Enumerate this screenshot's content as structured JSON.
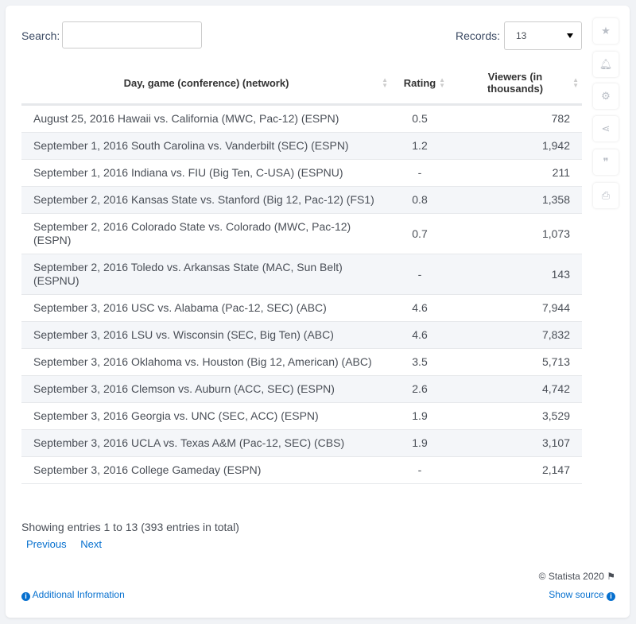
{
  "search": {
    "label": "Search:",
    "value": ""
  },
  "records": {
    "label": "Records:",
    "value": "13"
  },
  "columns": [
    "Day, game (conference) (network)",
    "Rating",
    "Viewers (in thousands)"
  ],
  "rows": [
    [
      "August 25, 2016 Hawaii vs. California (MWC, Pac-12) (ESPN)",
      "0.5",
      "782"
    ],
    [
      "September 1, 2016 South Carolina vs. Vanderbilt (SEC) (ESPN)",
      "1.2",
      "1,942"
    ],
    [
      "September 1, 2016 Indiana vs. FIU (Big Ten, C-USA) (ESPNU)",
      "-",
      "211"
    ],
    [
      "September 2, 2016 Kansas State vs. Stanford (Big 12, Pac-12) (FS1)",
      "0.8",
      "1,358"
    ],
    [
      "September 2, 2016 Colorado State vs. Colorado (MWC, Pac-12) (ESPN)",
      "0.7",
      "1,073"
    ],
    [
      "September 2, 2016 Toledo vs. Arkansas State (MAC, Sun Belt) (ESPNU)",
      "-",
      "143"
    ],
    [
      "September 3, 2016 USC vs. Alabama (Pac-12, SEC) (ABC)",
      "4.6",
      "7,944"
    ],
    [
      "September 3, 2016 LSU vs. Wisconsin (SEC, Big Ten) (ABC)",
      "4.6",
      "7,832"
    ],
    [
      "September 3, 2016 Oklahoma vs. Houston (Big 12, American) (ABC)",
      "3.5",
      "5,713"
    ],
    [
      "September 3, 2016 Clemson vs. Auburn (ACC, SEC) (ESPN)",
      "2.6",
      "4,742"
    ],
    [
      "September 3, 2016 Georgia vs. UNC (SEC, ACC) (ESPN)",
      "1.9",
      "3,529"
    ],
    [
      "September 3, 2016 UCLA vs. Texas A&M (Pac-12, SEC) (CBS)",
      "1.9",
      "3,107"
    ],
    [
      "September 3, 2016 College Gameday (ESPN)",
      "-",
      "2,147"
    ]
  ],
  "footer": {
    "showing": "Showing entries 1 to 13 (393 entries in total)",
    "previous": "Previous",
    "next": "Next",
    "copyright": "© Statista 2020",
    "additional": "Additional Information",
    "source": "Show source"
  }
}
